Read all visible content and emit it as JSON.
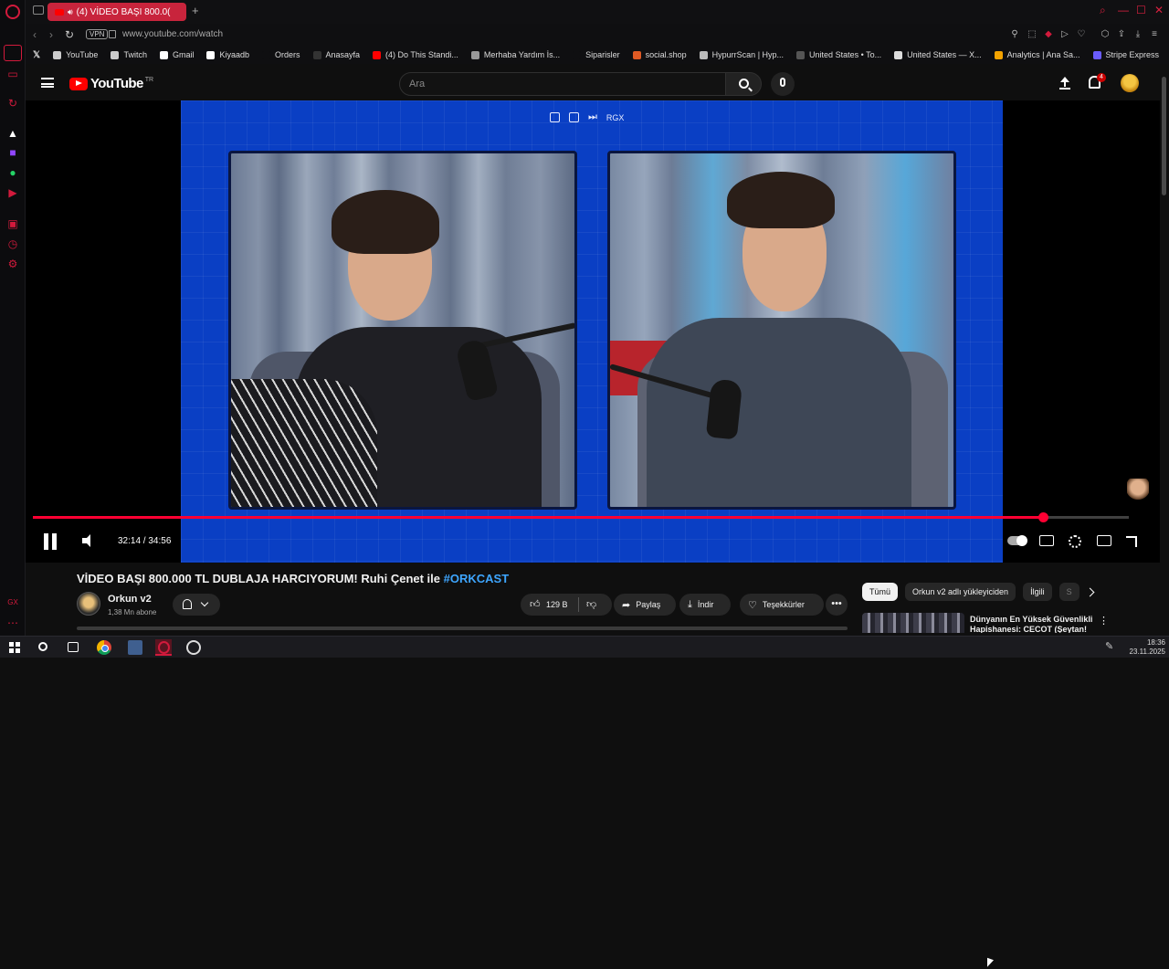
{
  "browser": {
    "tab_title": "(4) VİDEO BAŞI 800.0(",
    "new_tab": "+",
    "vpn_label": "VPN",
    "url": "www.youtube.com/watch",
    "bookmarks": [
      {
        "label": "YouTube",
        "icon": "file-icon",
        "color": "#cccccc"
      },
      {
        "label": "Twitch",
        "icon": "file-icon",
        "color": "#cccccc"
      },
      {
        "label": "Gmail",
        "icon": "google-icon",
        "color": "#ffffff"
      },
      {
        "label": "Kiyaadb",
        "icon": "a-icon",
        "color": "#ffffff"
      },
      {
        "label": "Orders",
        "icon": "blank-icon",
        "color": "#0f0f11"
      },
      {
        "label": "Anasayfa",
        "icon": "triangle-icon",
        "color": "#333333"
      },
      {
        "label": "(4) Do This Standi...",
        "icon": "youtube-icon",
        "color": "#ff0000"
      },
      {
        "label": "Merhaba Yardım İs...",
        "icon": "globe-icon",
        "color": "#999999"
      },
      {
        "label": "Siparisler",
        "icon": "blank-icon",
        "color": "#0f0f11"
      },
      {
        "label": "social.shop",
        "icon": "shop-icon",
        "color": "#e05a24"
      },
      {
        "label": "HypurrScan | Hyp...",
        "icon": "hyper-icon",
        "color": "#bbbbbb"
      },
      {
        "label": "United States • To...",
        "icon": "chart-icon",
        "color": "#555555"
      },
      {
        "label": "United States — X...",
        "icon": "globe-icon",
        "color": "#dddddd"
      },
      {
        "label": "Analytics | Ana Sa...",
        "icon": "analytics-icon",
        "color": "#f4a300"
      },
      {
        "label": "Stripe Express",
        "icon": "stripe-icon",
        "color": "#6a5cff"
      }
    ]
  },
  "youtube": {
    "logo_text": "YouTube",
    "logo_region": "TR",
    "search_placeholder": "Ara",
    "notification_count": "4"
  },
  "player": {
    "overlay_label": "RGX",
    "current_time": "32:14",
    "duration": "34:56",
    "time_display": "32:14 / 34:56",
    "progress_fraction": 0.922,
    "stage_color": "#0a3fc4"
  },
  "video": {
    "title_main": "VİDEO BAŞI 800.000 TL DUBLAJA HARCIYORUM! Ruhi Çenet ile ",
    "title_hashtag": "#ORKCAST",
    "channel_name": "Orkun v2",
    "channel_subs": "1,38 Mn abone",
    "likes": "129 B",
    "share_label": "Paylaş",
    "download_label": "İndir",
    "thanks_label": "Teşekkürler",
    "more_label": "•••"
  },
  "sidebar_recs": {
    "chips": [
      "Tümü",
      "Orkun v2 adlı yükleyiciden",
      "İlgili",
      "S"
    ],
    "first_title": "Dünyanın En Yüksek Güvenlikli Hapishanesi: CECOT (Şeytan!"
  },
  "taskbar": {
    "time": "18:36",
    "date": "23.11.2025"
  },
  "colors": {
    "accent": "#d21a3c",
    "youtube_red": "#ff0000",
    "progress": "#ff0033",
    "link_blue": "#3ea6ff"
  }
}
